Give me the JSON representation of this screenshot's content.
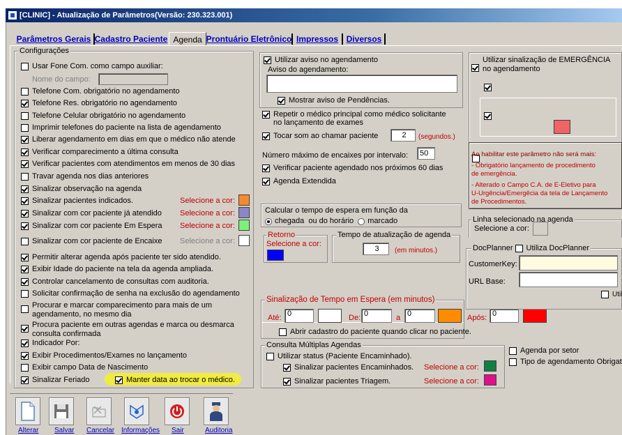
{
  "window": {
    "title": "[CLINIC] - Atualização de Parâmetros(Versão: 230.323.001)"
  },
  "tabs": [
    {
      "label": "Parâmetros Gerais",
      "active": false
    },
    {
      "label": "Cadastro Paciente",
      "active": false
    },
    {
      "label": "Agenda",
      "active": true
    },
    {
      "label": "Prontuário Eletrônico",
      "active": false
    },
    {
      "label": "Impressos",
      "active": false
    },
    {
      "label": "Diversos",
      "active": false
    }
  ],
  "config": {
    "legend": "Configurações",
    "items": [
      {
        "label": "Usar Fone Com. como campo auxiliar:",
        "checked": false
      },
      {
        "label": "Telefone Com. obrigatório no agendamento",
        "checked": false
      },
      {
        "label": "Telefone Res. obrigatório no agendamento",
        "checked": true
      },
      {
        "label": "Telefone Celular obrigatório no agendamento",
        "checked": false
      },
      {
        "label": "Imprimir telefones do paciente na lista de agendamento",
        "checked": false
      },
      {
        "label": "Liberar agendamento em dias em que o médico não atende",
        "checked": true
      },
      {
        "label": "Verificar comparecimento a última consulta",
        "checked": true
      },
      {
        "label": "Verificar pacientes com atendimentos em menos de 30 dias",
        "checked": true
      },
      {
        "label": "Travar agenda nos dias anteriores",
        "checked": false
      },
      {
        "label": "Sinalizar observação na agenda",
        "checked": true
      },
      {
        "label": "Sinalizar pacientes indicados.",
        "checked": true
      },
      {
        "label": "Sinalizar com cor paciente já atendido",
        "checked": true
      },
      {
        "label": "Sinalizar com cor paciente Em Espera",
        "checked": true
      },
      {
        "label": "Sinalizar com cor paciente de Encaixe",
        "checked": false
      },
      {
        "label": "Permitir alterar agenda após paciente ter sido atendido.",
        "checked": true
      },
      {
        "label": "Exibir Idade do paciente na tela da agenda ampliada.",
        "checked": true
      },
      {
        "label": "Controlar cancelamento de consultas com auditoria.",
        "checked": true
      },
      {
        "label": "Solicitar confirmação de senha na exclusão do agendamento",
        "checked": false
      },
      {
        "label": "Procurar e marcar comparecimento para mais de um",
        "label2": "agendamento, no mesmo dia",
        "checked": false
      },
      {
        "label": "Procura paciente em outras agendas e marca ou desmarca",
        "label2": "consulta confirmada",
        "checked": true
      },
      {
        "label": "Indicador Por:",
        "checked": true
      },
      {
        "label": "Exibir Procedimentos/Exames no lançamento",
        "checked": true
      },
      {
        "label": "Exibir campo Data de Nascimento",
        "checked": false
      },
      {
        "label": "Sinalizar Feriado",
        "checked": true
      }
    ],
    "nome_campo_label": "Nome do campo:",
    "nome_campo_value": "",
    "select_color_label": "Selecione a cor:",
    "colors": [
      "#f58a2c",
      "#8b86c8",
      "#7cf07c",
      "#ffffff"
    ],
    "manter_data": {
      "label": "Manter data ao trocar o médico.",
      "checked": true
    }
  },
  "aviso": {
    "utilizar": {
      "label": "Utilizar aviso no agendamento",
      "checked": true
    },
    "aviso_label": "Aviso do agendamento:",
    "aviso_value": "",
    "pendencias": {
      "label": "Mostrar aviso de Pendências.",
      "checked": true
    }
  },
  "mid": {
    "repetir": {
      "label": "Repetir o médico principal como médico solicitante",
      "label2": "no lançamento de exames",
      "checked": true
    },
    "tocar": {
      "label": "Tocar som ao chamar paciente",
      "checked": true,
      "value": "2",
      "unit": "(segundos.)"
    },
    "encaixes": {
      "label": "Número máximo de encaixes por intervalo:",
      "value": "50"
    },
    "verificar60": {
      "label": "Verificar paciente agendado nos próximos 60 dias",
      "checked": true
    },
    "extendida": {
      "label": "Agenda Extendida",
      "checked": true
    }
  },
  "espera": {
    "title": "Calcular o tempo de espera em função da",
    "opt1": "chegada",
    "mid": "ou do horário",
    "opt2": "marcado",
    "selected": "chegada"
  },
  "retorno": {
    "legend": "Retorno",
    "label": "Selecione a cor:",
    "color": "#0000ff"
  },
  "tempo": {
    "legend": "Tempo de atualização de agenda",
    "value": "3",
    "unit": "(em minutos.)"
  },
  "sinal_tempo": {
    "legend": "Sinalização de Tempo em Espera (em minutos)",
    "ate_label": "Até:",
    "ate_value": "0",
    "ate_color": "#ffffff",
    "de_label": "De:",
    "de_value": "0",
    "a_label": "a",
    "a_value": "0",
    "de_color": "#ff8c00",
    "apos_label": "Após:",
    "apos_value": "0",
    "apos_color": "#ff0000",
    "abrir": {
      "label": "Abrir cadastro do paciente quando clicar no paciente.",
      "checked": false
    }
  },
  "multiplas": {
    "legend": "Consulta Múltiplas Agendas",
    "utilizar": {
      "label": "Utilizar status (Paciente Encaminhado).",
      "checked": false
    },
    "encaminhados": {
      "label": "Sinalizar pacientes Encaminhados.",
      "checked": true,
      "color_label": "Selecione a cor:",
      "color": "#108040"
    },
    "triagem": {
      "label": "Sinalizar pacientes Triagem.",
      "checked": true,
      "color_label": "Selecione a cor:",
      "color": "#e0108a"
    }
  },
  "emergencia": {
    "label": "Utilizar sinalização de EMERGÊNCIA",
    "label2": "no agendamento",
    "checked": true,
    "sub1": true,
    "sub2": true,
    "color": "#f06464",
    "notice_checked": false,
    "notice": [
      "Ao habilitar este parâmetro não será mais:",
      "- Obrigatório lançamento de procedimento",
      "de emergência.",
      "- Alterado o Campo C.A. de E-Eletivo para",
      "U-Urgência/Emergêcia  da tela de Lançamento",
      "de Procedimentos."
    ]
  },
  "linha": {
    "legend": "Linha selecionado na agenda",
    "label": "Selecione a cor:",
    "color": "#d4d0c8"
  },
  "docplanner": {
    "legend": "DocPlanner",
    "utiliza": {
      "label": "Utiliza DocPlanner",
      "checked": false
    },
    "key_label": "CustomerKey:",
    "key_value": "",
    "url_label": "URL Base:",
    "url_value": "",
    "util_label": "Util",
    "util_checked": false
  },
  "right_bottom": {
    "por_setor": {
      "label": "Agenda por setor",
      "checked": false
    },
    "tipo_obrig": {
      "label": "Tipo de agendamento Obrigatório",
      "checked": false
    }
  },
  "toolbar": [
    {
      "label": "Alterar",
      "icon": "document-icon"
    },
    {
      "label": "Salvar",
      "icon": "floppy-disk-icon"
    },
    {
      "label": "Cancelar",
      "icon": "folder-icon"
    },
    {
      "label": "Informações",
      "icon": "info-icon"
    },
    {
      "label": "Sair",
      "icon": "power-icon"
    },
    {
      "label": "Auditoria",
      "icon": "auditor-icon"
    }
  ]
}
